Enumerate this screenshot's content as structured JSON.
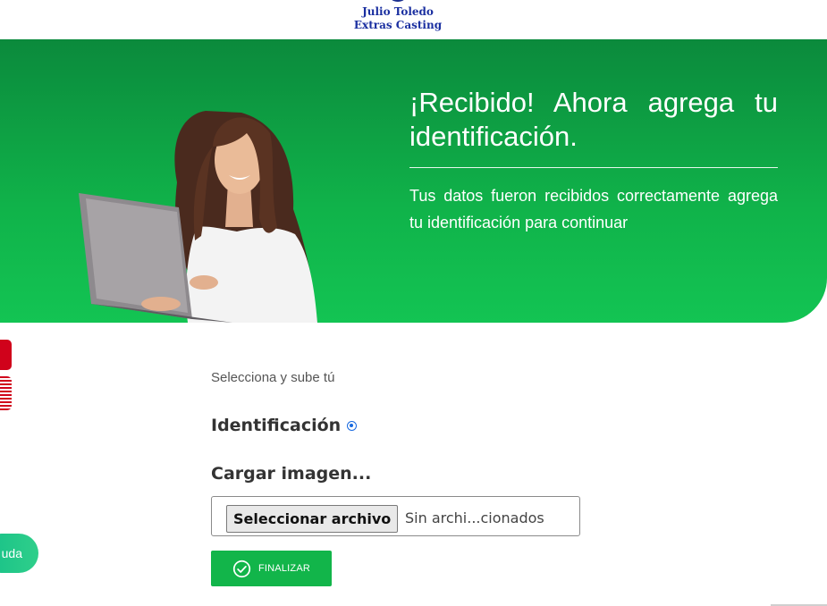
{
  "header": {
    "logo_line1": "Julio Toledo",
    "logo_line2": "Extras Casting"
  },
  "hero": {
    "title": "¡Recibido! Ahora agrega tu identificación.",
    "text": "Tus datos fueron recibidos correctamente agrega tu identificación para continuar"
  },
  "form": {
    "intro": "Selecciona y sube tú",
    "id_label": "Identificación",
    "upload_label": "Cargar imagen...",
    "file_button": "Seleccionar archivo",
    "file_status": "Sin archi...cionados",
    "finish_label": "FINALIZAR"
  },
  "help": {
    "label": "uda"
  },
  "colors": {
    "accent": "#12b54a",
    "hero_top": "#0b8a3c",
    "hero_bottom": "#13c453",
    "logo_blue": "#1a2fa0",
    "side_red": "#d0021b",
    "radio_blue": "#1769e0"
  },
  "icons": [
    "check-circle-icon",
    "radio-selected-icon"
  ]
}
